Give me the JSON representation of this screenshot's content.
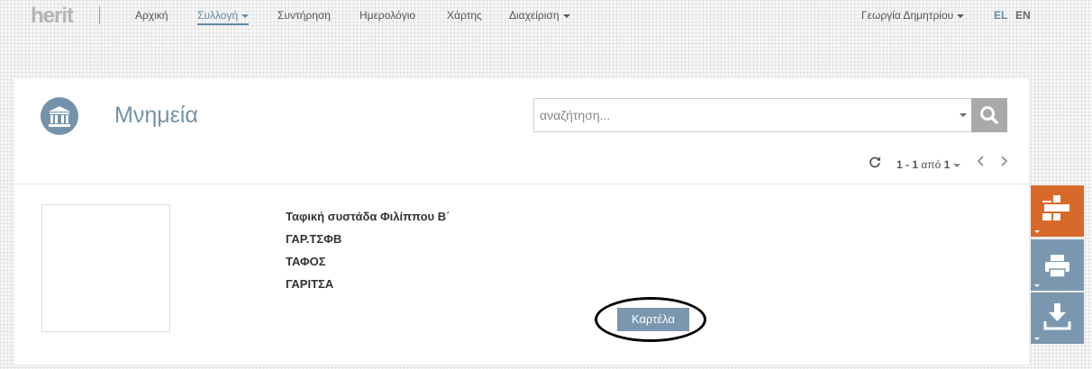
{
  "logo": {
    "text": "herit"
  },
  "nav": {
    "items": [
      {
        "label": "Αρχική"
      },
      {
        "label": "Συλλογή"
      },
      {
        "label": "Συντήρηση"
      },
      {
        "label": "Ημερολόγιο"
      },
      {
        "label": "Χάρτης"
      },
      {
        "label": "Διαχείριση"
      }
    ],
    "user": "Γεωργία Δημητρίου",
    "lang_el": "EL",
    "lang_en": "EN"
  },
  "page": {
    "title": "Μνημεία",
    "search_placeholder": "αναζήτηση..."
  },
  "pager": {
    "range": "1 - 1",
    "of": "από",
    "total": "1"
  },
  "record": {
    "name": "Ταφική συστάδα Φιλίππου Β΄",
    "code": "ΓΑΡ.ΤΣΦΒ",
    "type": "ΤΑΦΟΣ",
    "location": "ΓΑΡΙΤΣΑ",
    "card_button": "Καρτέλα"
  },
  "colors": {
    "accent": "#7b97b0",
    "add_button": "#d9692a"
  },
  "icons": {
    "section": "museum-icon",
    "search": "search-icon",
    "refresh": "refresh-icon",
    "add": "add-icon",
    "print": "print-icon",
    "download": "download-icon"
  }
}
